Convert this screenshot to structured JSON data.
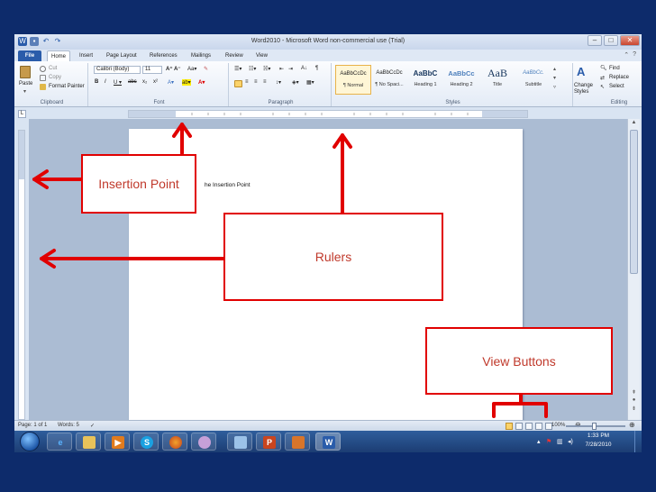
{
  "window": {
    "title": "Word2010 - Microsoft Word non-commercial use (Trial)"
  },
  "ribbon_tabs": [
    "File",
    "Home",
    "Insert",
    "Page Layout",
    "References",
    "Mailings",
    "Review",
    "View"
  ],
  "clipboard": {
    "paste_label": "Paste",
    "cut_label": "Cut",
    "copy_label": "Copy",
    "format_painter_label": "Format Painter",
    "group_label": "Clipboard"
  },
  "font": {
    "font_name": "Calibri (Body)",
    "font_size": "11",
    "group_label": "Font"
  },
  "paragraph": {
    "group_label": "Paragraph"
  },
  "styles": {
    "items": [
      {
        "preview": "AaBbCcDc",
        "name": "¶ Normal"
      },
      {
        "preview": "AaBbCcDc",
        "name": "¶ No Spaci..."
      },
      {
        "preview": "AaBbC",
        "name": "Heading 1"
      },
      {
        "preview": "AaBbCc",
        "name": "Heading 2"
      },
      {
        "preview": "AaB",
        "name": "Title"
      },
      {
        "preview": "AaBbCc.",
        "name": "Subtitle"
      }
    ],
    "change_styles_label": "Change Styles",
    "group_label": "Styles"
  },
  "editing": {
    "find_label": "Find",
    "replace_label": "Replace",
    "select_label": "Select",
    "group_label": "Editing"
  },
  "document": {
    "text": "he Insertion Point"
  },
  "statusbar": {
    "page": "Page: 1 of 1",
    "words": "Words: 5",
    "zoom": "100%"
  },
  "taskbar": {
    "time": "1:33 PM",
    "date": "7/28/2010"
  },
  "callouts": {
    "insertion_point": "Insertion Point",
    "rulers": "Rulers",
    "view_buttons": "View Buttons"
  },
  "colors": {
    "annotation": "#e10000",
    "file_tab": "#2a5caa",
    "frame": "#0d2b6b"
  }
}
